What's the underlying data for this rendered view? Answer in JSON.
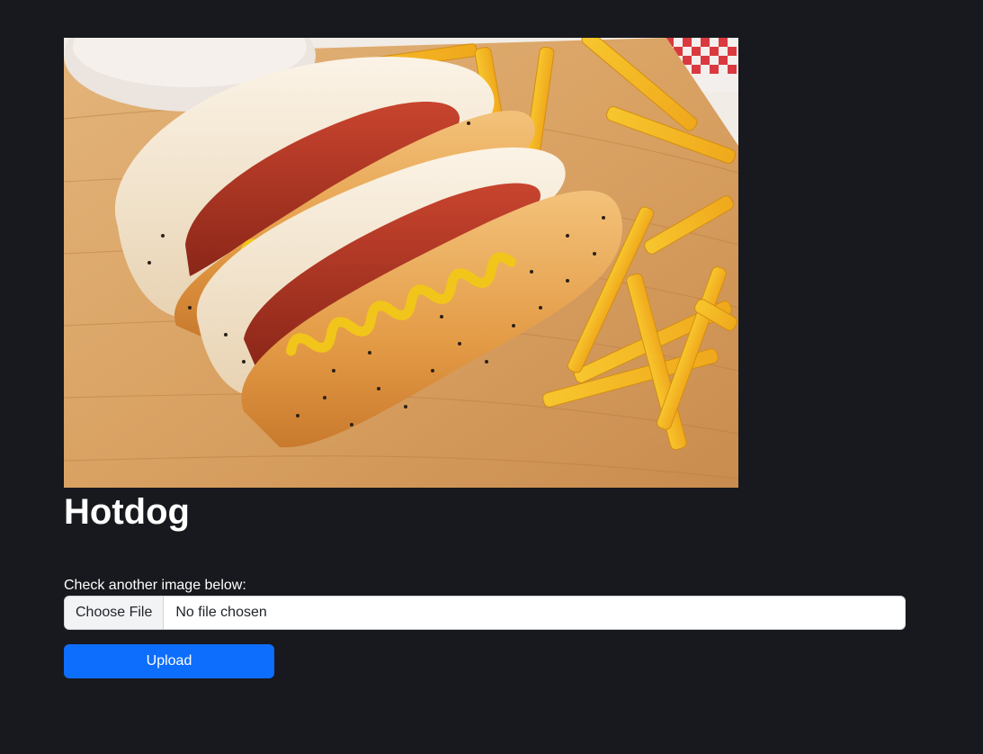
{
  "result": {
    "label": "Hotdog"
  },
  "upload_form": {
    "prompt_label": "Check another image below:",
    "choose_file_label": "Choose File",
    "file_status": "No file chosen",
    "upload_button_label": "Upload"
  },
  "colors": {
    "page_background": "#18191e",
    "primary_button": "#0d6efd",
    "text": "#ffffff"
  }
}
